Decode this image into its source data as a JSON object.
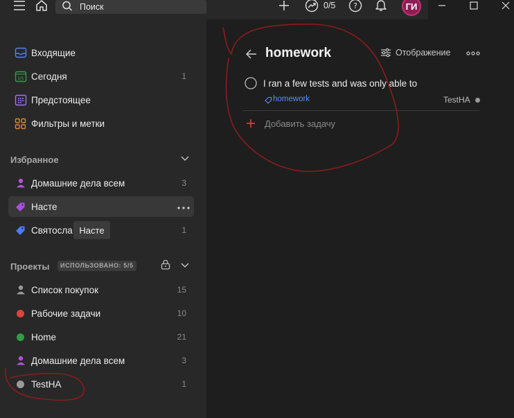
{
  "header": {
    "search_label": "Поиск",
    "productivity": "0/5",
    "avatar_initials": "ГИ"
  },
  "sidebar": {
    "nav": [
      {
        "label": "Входящие",
        "icon": "inbox-icon",
        "count": ""
      },
      {
        "label": "Сегодня",
        "icon": "calendar-today-icon",
        "day": "05",
        "count": "1"
      },
      {
        "label": "Предстоящее",
        "icon": "calendar-upcoming-icon",
        "count": ""
      },
      {
        "label": "Фильтры и метки",
        "icon": "filters-labels-icon",
        "count": ""
      }
    ],
    "favorites": {
      "title": "Избранное",
      "items": [
        {
          "label": "Домашние дела всем",
          "icon": "person-icon",
          "color": "#b152d6",
          "count": "3"
        },
        {
          "label": "Насте",
          "icon": "label-tag-icon",
          "color": "#a94ee0",
          "count": ""
        },
        {
          "label": "Святосла",
          "icon": "label-tag-icon",
          "color": "#4a7cff",
          "count": "1"
        }
      ],
      "tooltip": "Насте"
    },
    "projects": {
      "title": "Проекты",
      "usage_badge": "ИСПОЛЬЗОВАНО: 5/5",
      "items": [
        {
          "label": "Список покупок",
          "icon": "person-icon",
          "color": "#9a9a9a",
          "count": "15"
        },
        {
          "label": "Рабочие задачи",
          "icon": "dot-icon",
          "color": "#e0423e",
          "count": "10"
        },
        {
          "label": "Home",
          "icon": "dot-icon",
          "color": "#2ea043",
          "count": "21"
        },
        {
          "label": "Домашние дела всем",
          "icon": "person-icon",
          "color": "#b152d6",
          "count": "3"
        },
        {
          "label": "TestHA",
          "icon": "dot-icon",
          "color": "#9a9a9a",
          "count": "1"
        }
      ]
    }
  },
  "main": {
    "title": "homework",
    "display_label": "Отображение",
    "task": {
      "title": "I ran a few tests and was only able to",
      "tag": "homework",
      "project": "TestHA"
    },
    "add_task_label": "Добавить задачу"
  },
  "colors": {
    "accent": "#dc4c3e",
    "annotation": "#8b1c1c"
  }
}
